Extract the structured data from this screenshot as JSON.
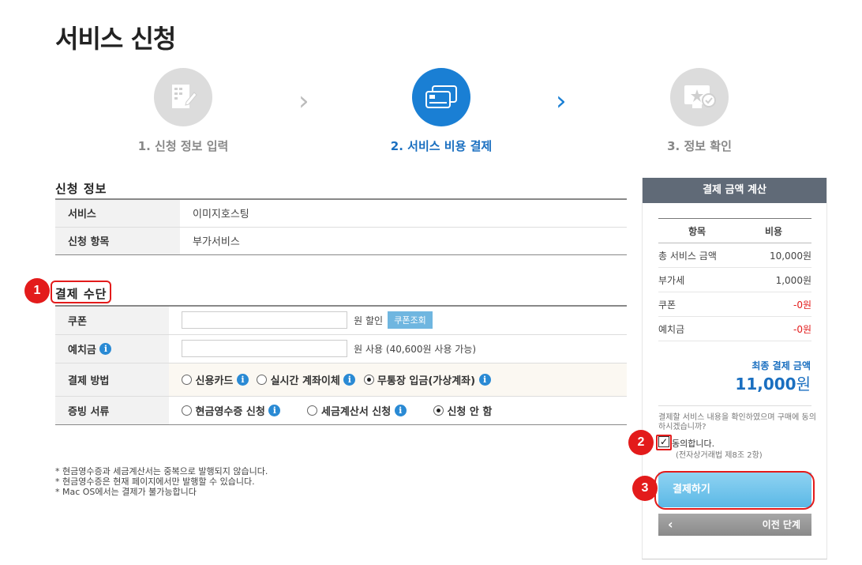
{
  "page_title": "서비스 신청",
  "steps": [
    {
      "label": "1. 신청 정보 입력",
      "icon": "document-edit-icon",
      "active": false
    },
    {
      "label": "2. 서비스 비용 결제",
      "icon": "credit-card-icon",
      "active": true
    },
    {
      "label": "3. 정보 확인",
      "icon": "monitor-check-icon",
      "active": false
    }
  ],
  "application_info": {
    "title": "신청 정보",
    "rows": [
      {
        "label": "서비스",
        "value": "이미지호스팅"
      },
      {
        "label": "신청 항목",
        "value": "부가서비스"
      }
    ]
  },
  "payment_method": {
    "title": "결제 수단",
    "coupon_label": "쿠폰",
    "coupon_suffix": "원 할인",
    "coupon_button": "쿠폰조회",
    "deposit_label": "예치금",
    "deposit_suffix": "원 사용 (40,600원 사용 가능)",
    "method_label": "결제 방법",
    "methods": [
      "신용카드",
      "실시간 계좌이체",
      "무통장 입금(가상계좌)"
    ],
    "method_selected": "무통장 입금(가상계좌)",
    "receipt_label": "증빙 서류",
    "receipts": [
      "현금영수증 신청",
      "세금계산서 신청",
      "신청 안 함"
    ],
    "receipt_selected": "신청 안 함"
  },
  "notes": [
    "* 현금영수증과 세금계산서는 중복으로 발행되지 않습니다.",
    "* 현금영수증은 현재 페이지에서만 발행할 수 있습니다.",
    "* Mac OS에서는 결제가 불가능합니다"
  ],
  "summary": {
    "header": "결제 금액 계산",
    "col_item": "항목",
    "col_cost": "비용",
    "rows": [
      {
        "label": "총 서비스 금액",
        "value": "10,000원",
        "red": false
      },
      {
        "label": "부가세",
        "value": "1,000원",
        "red": false
      },
      {
        "label": "쿠폰",
        "value": "-0원",
        "red": true
      },
      {
        "label": "예치금",
        "value": "-0원",
        "red": true
      }
    ],
    "final_label": "최종 결제 금액",
    "final_amount": "11,000",
    "final_unit": "원",
    "confirm_text": "결제할 서비스 내용을 확인하였으며 구매에 동의하시겠습니까?",
    "agree_checked": true,
    "agree_label": "동의합니다.",
    "law_note": "(전자상거래법 제8조 2항)",
    "pay_button": "결제하기",
    "prev_button": "이전 단계"
  },
  "badges": [
    "1",
    "2",
    "3"
  ],
  "colors": {
    "accent": "#1a7fd4",
    "highlight": "#e31b1b",
    "header": "#606a77"
  }
}
